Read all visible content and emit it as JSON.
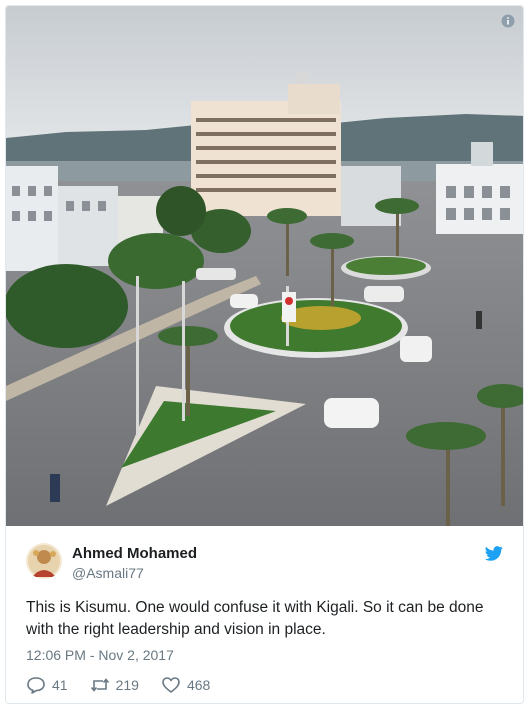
{
  "tweet": {
    "name": "Ahmed Mohamed",
    "handle": "@Asmali77",
    "text": "This is Kisumu. One would confuse it with Kigali. So it can be done with the right leadership and vision in place.",
    "timestamp": "12:06 PM - Nov 2, 2017",
    "replies": "41",
    "retweets": "219",
    "likes": "468"
  },
  "colors": {
    "twitter_blue": "#1da1f2",
    "meta_gray": "#697882"
  },
  "icons": [
    "info-icon",
    "twitter-bird-icon",
    "reply-icon",
    "retweet-icon",
    "heart-icon"
  ]
}
